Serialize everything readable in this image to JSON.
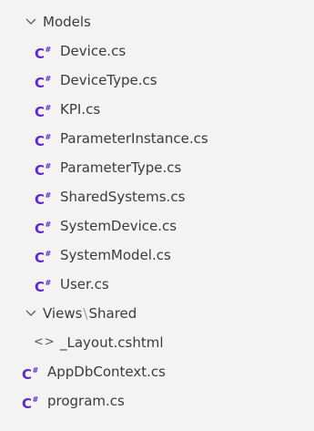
{
  "explorer": {
    "folder_models": {
      "label": "Models",
      "files": [
        {
          "name": "Device.cs",
          "icon": "csharp-file-icon"
        },
        {
          "name": "DeviceType.cs",
          "icon": "csharp-file-icon"
        },
        {
          "name": "KPI.cs",
          "icon": "csharp-file-icon"
        },
        {
          "name": "ParameterInstance.cs",
          "icon": "csharp-file-icon"
        },
        {
          "name": "ParameterType.cs",
          "icon": "csharp-file-icon"
        },
        {
          "name": "SharedSystems.cs",
          "icon": "csharp-file-icon"
        },
        {
          "name": "SystemDevice.cs",
          "icon": "csharp-file-icon"
        },
        {
          "name": "SystemModel.cs",
          "icon": "csharp-file-icon"
        },
        {
          "name": "User.cs",
          "icon": "csharp-file-icon"
        }
      ]
    },
    "folder_views": {
      "part1": "Views",
      "separator": "\\",
      "part2": "Shared",
      "files": [
        {
          "name": "_Layout.cshtml",
          "icon": "html-file-icon"
        }
      ]
    },
    "root_files": [
      {
        "name": "AppDbContext.cs",
        "icon": "csharp-file-icon"
      },
      {
        "name": "program.cs",
        "icon": "csharp-file-icon"
      }
    ],
    "icon_glyphs": {
      "csharp": "C",
      "csharp_sup": "#",
      "html": "<>"
    },
    "colors": {
      "background": "#f3f3f3",
      "text": "#3b3b3b",
      "csharp_icon": "#5d2ac7",
      "html_icon": "#555555"
    }
  }
}
